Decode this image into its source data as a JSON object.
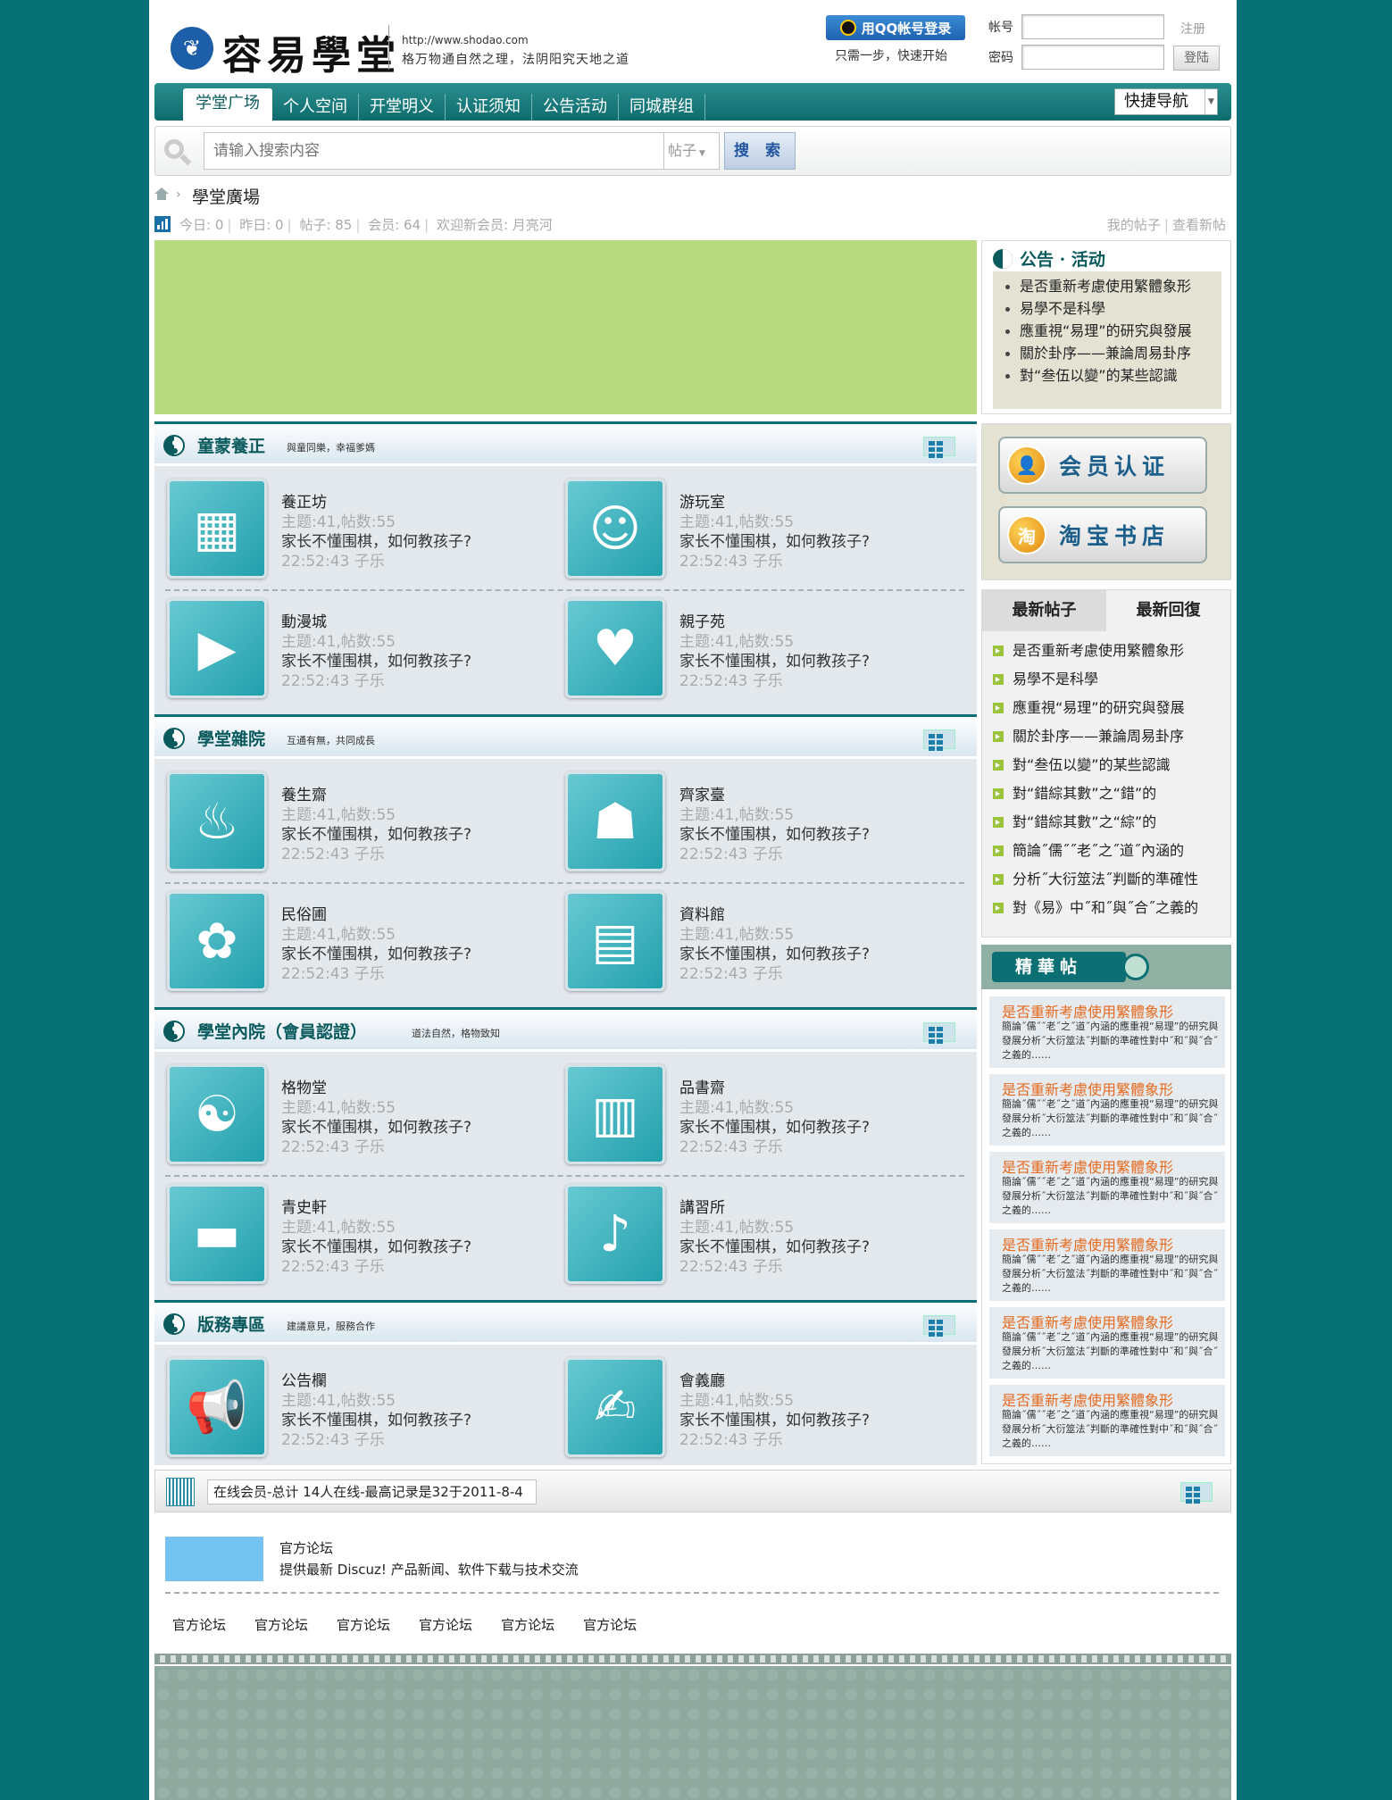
{
  "header": {
    "logo_title": "容易學堂",
    "site_url": "http://www.shodao.com",
    "slogan": "格万物通自然之理，法阴阳究天地之道",
    "qq_login": "用QQ帐号登录",
    "qq_tip": "只需一步，快速开始",
    "account_label": "帐号",
    "password_label": "密码",
    "register": "注册",
    "login": "登陆"
  },
  "nav": {
    "items": [
      "学堂广场",
      "个人空间",
      "开堂明义",
      "认证须知",
      "公告活动",
      "同城群组"
    ],
    "quick_nav": "快捷导航"
  },
  "search": {
    "placeholder": "请输入搜索内容",
    "type": "帖子",
    "button": "搜 索"
  },
  "breadcrumb": "學堂廣場",
  "stats": {
    "today": "今日: 0",
    "yesterday": "昨日: 0",
    "posts": "帖子: 85",
    "members": "会员: 64",
    "newest": "欢迎新会员: 月亮河",
    "my_posts": "我的帖子",
    "view_new": "查看新帖"
  },
  "categories": [
    {
      "title": "童蒙養正",
      "subtitle": "與童同樂，幸福爹媽",
      "forums": [
        {
          "name": "養正坊",
          "icon": "grid-icon",
          "glyph": "▦"
        },
        {
          "name": "游玩室",
          "icon": "child-play-icon",
          "glyph": "☺"
        },
        {
          "name": "動漫城",
          "icon": "film-icon",
          "glyph": "▶"
        },
        {
          "name": "親子苑",
          "icon": "mother-child-icon",
          "glyph": "♥"
        }
      ]
    },
    {
      "title": "學堂雜院",
      "subtitle": "互通有無，共同成長",
      "forums": [
        {
          "name": "養生齋",
          "icon": "acupuncture-figure-icon",
          "glyph": "♨"
        },
        {
          "name": "齊家臺",
          "icon": "family-icon",
          "glyph": "☗"
        },
        {
          "name": "民俗圃",
          "icon": "papercut-icon",
          "glyph": "✿"
        },
        {
          "name": "資料館",
          "icon": "archive-icon",
          "glyph": "▤"
        }
      ]
    },
    {
      "title": "學堂內院（會員認證）",
      "subtitle": "道法自然，格物致知",
      "forums": [
        {
          "name": "格物堂",
          "icon": "yin-yang-bagua-icon",
          "glyph": "☯"
        },
        {
          "name": "品書齋",
          "icon": "bamboo-scroll-icon",
          "glyph": "▥"
        },
        {
          "name": "青史軒",
          "icon": "books-icon",
          "glyph": "▬"
        },
        {
          "name": "講習所",
          "icon": "microphone-icon",
          "glyph": "♪"
        }
      ]
    },
    {
      "title": "版務專區",
      "subtitle": "建議意見，服務合作",
      "forums": [
        {
          "name": "公告欄",
          "icon": "megaphone-icon",
          "glyph": "📢"
        },
        {
          "name": "會義廳",
          "icon": "writing-icon",
          "glyph": "✍"
        }
      ]
    }
  ],
  "forum_common": {
    "stat": "主题:41,帖数:55",
    "last_post": "家长不懂围棋，如何教孩子?",
    "time_user": "22:52:43  子乐"
  },
  "announce": {
    "title": "公告 · 活动",
    "items": [
      "是否重新考慮使用繁體象形",
      "易學不是科學",
      "應重視“易理”的研究與發展",
      "關於卦序——兼論周易卦序",
      "對“叁伍以變”的某些認識"
    ]
  },
  "side_buttons": {
    "verify": "会员认证",
    "verify_glyph": "👤",
    "shop": "淘宝书店",
    "shop_glyph": "淘"
  },
  "latest": {
    "tab_posts": "最新帖子",
    "tab_replies": "最新回復",
    "items": [
      "是否重新考慮使用繁體象形",
      "易學不是科學",
      "應重視“易理”的研究與發展",
      "關於卦序——兼論周易卦序",
      "對“叁伍以變”的某些認識",
      "對“錯綜其數”之“錯”的",
      "對“錯綜其數”之“綜”的",
      "簡論˝儒˝˝老˝之˝道˝內涵的",
      "分析˝大衍筮法˝判斷的準確性",
      "對《易》中˝和˝與˝合˝之義的"
    ]
  },
  "digest": {
    "title": "精華帖",
    "items": [
      {
        "title": "是否重新考慮使用繁體象形",
        "desc": "簡論˝儒˝˝老˝之˝道˝內涵的應重視“易理”的研究與發展分析˝大衍筮法˝判斷的準確性對中˝和˝與˝合˝之義的……"
      },
      {
        "title": "是否重新考慮使用繁體象形",
        "desc": "簡論˝儒˝˝老˝之˝道˝內涵的應重視“易理”的研究與發展分析˝大衍筮法˝判斷的準確性對中˝和˝與˝合˝之義的……"
      },
      {
        "title": "是否重新考慮使用繁體象形",
        "desc": "簡論˝儒˝˝老˝之˝道˝內涵的應重視“易理”的研究與發展分析˝大衍筮法˝判斷的準確性對中˝和˝與˝合˝之義的……"
      },
      {
        "title": "是否重新考慮使用繁體象形",
        "desc": "簡論˝儒˝˝老˝之˝道˝內涵的應重視“易理”的研究與發展分析˝大衍筮法˝判斷的準確性對中˝和˝與˝合˝之義的……"
      },
      {
        "title": "是否重新考慮使用繁體象形",
        "desc": "簡論˝儒˝˝老˝之˝道˝內涵的應重視“易理”的研究與發展分析˝大衍筮法˝判斷的準確性對中˝和˝與˝合˝之義的……"
      },
      {
        "title": "是否重新考慮使用繁體象形",
        "desc": "簡論˝儒˝˝老˝之˝道˝內涵的應重視“易理”的研究與發展分析˝大衍筮法˝判斷的準確性對中˝和˝與˝合˝之義的……"
      }
    ]
  },
  "online": "在线会员-总计 14人在线-最高记录是32于2011-8-4",
  "friend_links": {
    "name": "官方论坛",
    "desc": "提供最新 Discuz! 产品新闻、软件下载与技术交流",
    "links": [
      "官方论坛",
      "官方论坛",
      "官方论坛",
      "官方论坛",
      "官方论坛",
      "官方论坛"
    ]
  },
  "colors": {
    "background": "#077176",
    "accent": "#0b5b5e",
    "banner": "#b9da80",
    "digest_title": "#e66a1e"
  }
}
